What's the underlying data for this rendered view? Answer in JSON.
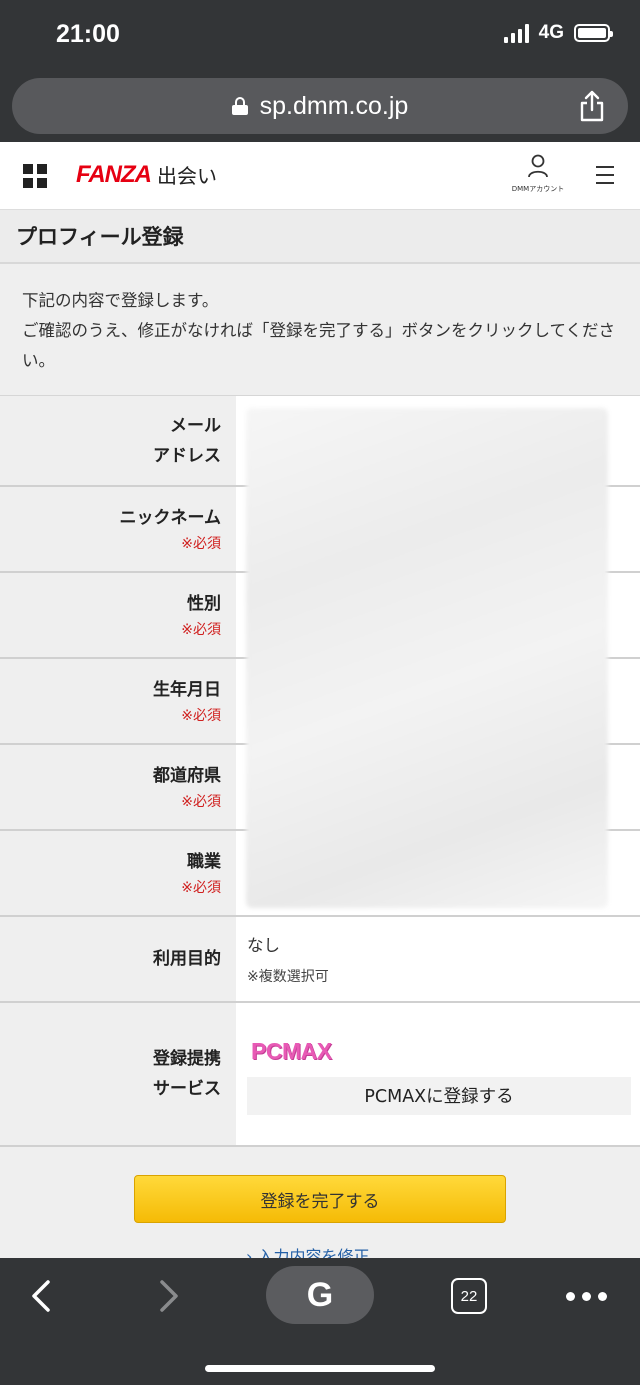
{
  "status_bar": {
    "time": "21:00",
    "network": "4G"
  },
  "browser": {
    "url": "sp.dmm.co.jp",
    "tab_count": "22",
    "google_label": "G"
  },
  "header": {
    "brand": "FANZA",
    "brand_sub": "出会い",
    "account_label": "DMMアカウント"
  },
  "page_title": "プロフィール登録",
  "intro": {
    "line1": "下記の内容で登録します。",
    "line2": "ご確認のうえ、修正がなければ「登録を完了する」ボタンをクリックしてください。"
  },
  "form": {
    "required_label": "※必須",
    "email_label": "メール\nアドレス",
    "nickname_label": "ニックネーム",
    "gender_label": "性別",
    "birthday_label": "生年月日",
    "prefecture_label": "都道府県",
    "occupation_label": "職業",
    "purpose_label": "利用目的",
    "purpose_value": "なし",
    "purpose_note": "※複数選択可",
    "partner_label": "登録提携\nサービス",
    "partner_logo": "PCMAX",
    "partner_button": "PCMAXに登録する"
  },
  "actions": {
    "complete_button": "登録を完了する",
    "edit_link": "› 入力内容を修正"
  },
  "colors": {
    "brand_red": "#e60012",
    "required_red": "#d0201f",
    "button_yellow": "#f5bb06",
    "pcmax_pink": "#e85ab5",
    "chrome_dark": "#333537"
  }
}
